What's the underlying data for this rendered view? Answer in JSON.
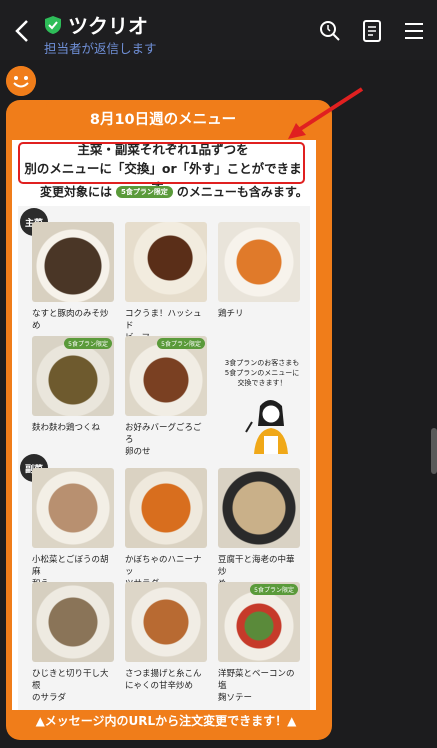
{
  "header": {
    "title": "ツクリオ",
    "subtitle": "担当者が返信します"
  },
  "icons": [
    "back-arrow-icon",
    "shield-check-icon",
    "search-icon",
    "notes-icon",
    "menu-icon"
  ],
  "card": {
    "week_title": "8月10日週のメニュー",
    "notice_line1": "主菜・副菜それぞれ1品ずつを",
    "notice_line2": "別のメニューに「交換」or「外す」ことができます。",
    "sub_note_prefix": "変更対象には",
    "sub_note_badge": "5食プラン限定",
    "sub_note_suffix": "のメニューも含みます。",
    "main_tag": "主菜",
    "side_tag": "副菜",
    "main_items": [
      {
        "name": "なすと豚肉のみそ炒め",
        "badge": ""
      },
      {
        "name": "コクうま！ハッシュド\nビーフ",
        "badge": ""
      },
      {
        "name": "鶏チリ",
        "badge": ""
      },
      {
        "name": "麸わ麸わ鶏つくね",
        "badge": "5食プラン限定"
      },
      {
        "name": "お好みバーグごろごろ\n卵のせ",
        "badge": "5食プラン限定"
      }
    ],
    "promo_text": "3食プランのお客さまも\n5食プランのメニューに\n交換できます！",
    "side_items": [
      {
        "name": "小松菜とごぼうの胡麻\n和え",
        "badge": ""
      },
      {
        "name": "かぼちゃのハニーナッ\nツサラダ",
        "badge": ""
      },
      {
        "name": "豆腐干と海老の中華炒\nめ",
        "badge": ""
      },
      {
        "name": "ひじきと切り干し大根\nのサラダ",
        "badge": ""
      },
      {
        "name": "さつま揚げと糸こん\nにゃくの甘辛炒め",
        "badge": ""
      },
      {
        "name": "洋野菜とベーコンの塩\n麹ソテー",
        "badge": "5食プラン限定"
      }
    ],
    "cta": "▲メッセージ内のURLから注文変更できます！▲"
  },
  "colors": {
    "accent": "#f07d1a",
    "badge_green": "#5a9a3a",
    "alert_red": "#e02020",
    "link_blue": "#6f8fd6"
  }
}
